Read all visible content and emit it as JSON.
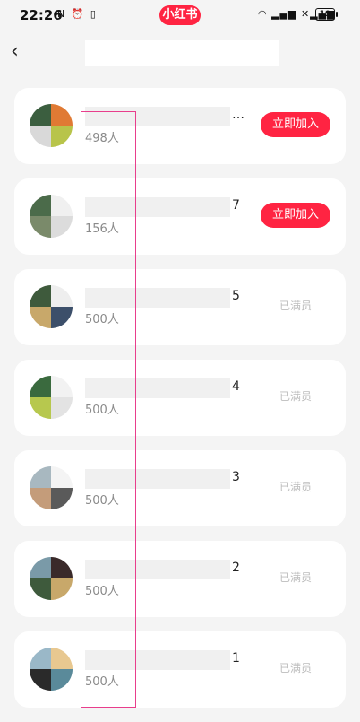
{
  "status_bar": {
    "time": "22:26",
    "app_pill": "小红书",
    "battery": "19"
  },
  "groups": [
    {
      "suffix": "…",
      "count": "498人",
      "action": "立即加入",
      "joinable": true,
      "avatar_colors": [
        "#3b5e3f",
        "#e07a34",
        "#d9d9d9",
        "#b8c44a"
      ]
    },
    {
      "suffix": "7",
      "count": "156人",
      "action": "立即加入",
      "joinable": true,
      "avatar_colors": [
        "#4b6b4a",
        "#f0f0f0",
        "#7a8a6a",
        "#dcdcdc"
      ]
    },
    {
      "suffix": "5",
      "count": "500人",
      "action": "已满员",
      "joinable": false,
      "avatar_colors": [
        "#3e5a3c",
        "#eeeeee",
        "#c8a86a",
        "#3c4f6a"
      ]
    },
    {
      "suffix": "4",
      "count": "500人",
      "action": "已满员",
      "joinable": false,
      "avatar_colors": [
        "#3a6a3e",
        "#f2f2f2",
        "#b7c84e",
        "#e3e3e3"
      ]
    },
    {
      "suffix": "3",
      "count": "500人",
      "action": "已满员",
      "joinable": false,
      "avatar_colors": [
        "#a8b8c0",
        "#f4f4f4",
        "#c49c7a",
        "#5a5a5a"
      ]
    },
    {
      "suffix": "2",
      "count": "500人",
      "action": "已满员",
      "joinable": false,
      "avatar_colors": [
        "#7a9aa8",
        "#3a2a2a",
        "#3e5a3c",
        "#c8a86a"
      ]
    },
    {
      "suffix": "1",
      "count": "500人",
      "action": "已满员",
      "joinable": false,
      "avatar_colors": [
        "#9ab8c8",
        "#e8c890",
        "#2a2a2a",
        "#5a8a9a"
      ]
    }
  ]
}
